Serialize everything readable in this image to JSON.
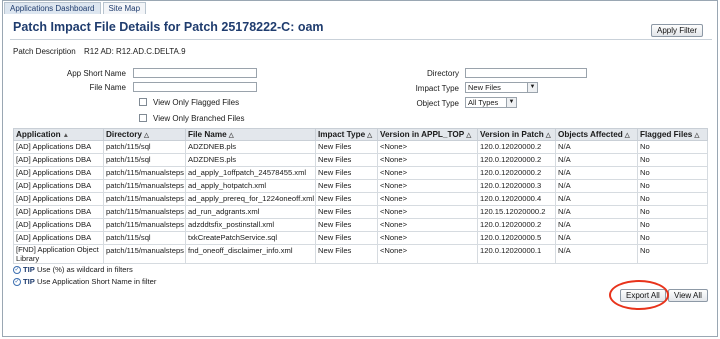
{
  "tabs": [
    "Applications Dashboard",
    "Site Map"
  ],
  "page_title": "Patch Impact File Details for Patch 25178222-C: oam",
  "apply_filter_label": "Apply Filter",
  "patch_description_label": "Patch Description",
  "patch_description_value": "R12 AD: R12.AD.C.DELTA.9",
  "filters": {
    "app_short_name_label": "App Short Name",
    "file_name_label": "File Name",
    "view_flagged_label": "View Only Flagged Files",
    "view_branched_label": "View Only Branched Files",
    "directory_label": "Directory",
    "impact_type_label": "Impact Type",
    "impact_type_value": "New Files",
    "object_type_label": "Object Type",
    "object_type_value": "All Types"
  },
  "table": {
    "columns": [
      "Application",
      "Directory",
      "File Name",
      "Impact Type",
      "Version in APPL_TOP",
      "Version in Patch",
      "Objects Affected",
      "Flagged Files"
    ],
    "rows": [
      [
        "[AD] Applications DBA",
        "patch/115/sql",
        "ADZDNEB.pls",
        "New Files",
        "<None>",
        "120.0.12020000.2",
        "N/A",
        "No"
      ],
      [
        "[AD] Applications DBA",
        "patch/115/sql",
        "ADZDNES.pls",
        "New Files",
        "<None>",
        "120.0.12020000.2",
        "N/A",
        "No"
      ],
      [
        "[AD] Applications DBA",
        "patch/115/manualsteps",
        "ad_apply_1offpatch_24578455.xml",
        "New Files",
        "<None>",
        "120.0.12020000.2",
        "N/A",
        "No"
      ],
      [
        "[AD] Applications DBA",
        "patch/115/manualsteps",
        "ad_apply_hotpatch.xml",
        "New Files",
        "<None>",
        "120.0.12020000.3",
        "N/A",
        "No"
      ],
      [
        "[AD] Applications DBA",
        "patch/115/manualsteps",
        "ad_apply_prereq_for_1224oneoff.xml",
        "New Files",
        "<None>",
        "120.0.12020000.4",
        "N/A",
        "No"
      ],
      [
        "[AD] Applications DBA",
        "patch/115/manualsteps",
        "ad_run_adgrants.xml",
        "New Files",
        "<None>",
        "120.15.12020000.2",
        "N/A",
        "No"
      ],
      [
        "[AD] Applications DBA",
        "patch/115/manualsteps",
        "adzddtsfix_postinstall.xml",
        "New Files",
        "<None>",
        "120.0.12020000.2",
        "N/A",
        "No"
      ],
      [
        "[AD] Applications DBA",
        "patch/115/sql",
        "txkCreatePatchService.sql",
        "New Files",
        "<None>",
        "120.0.12020000.5",
        "N/A",
        "No"
      ],
      [
        "[FND] Application Object Library",
        "patch/115/manualsteps",
        "fnd_oneoff_disclaimer_info.xml",
        "New Files",
        "<None>",
        "120.0.12020000.1",
        "N/A",
        "No"
      ]
    ]
  },
  "tips": [
    {
      "label": "TIP",
      "text": "Use (%) as wildcard in filters"
    },
    {
      "label": "TIP",
      "text": "Use Application Short Name in filter"
    }
  ],
  "export_all_label": "Export All",
  "view_all_label": "View All",
  "colors": {
    "title": "#1f3c6e",
    "highlight": "#e8331b",
    "header_bg": "#e3e7ec"
  }
}
